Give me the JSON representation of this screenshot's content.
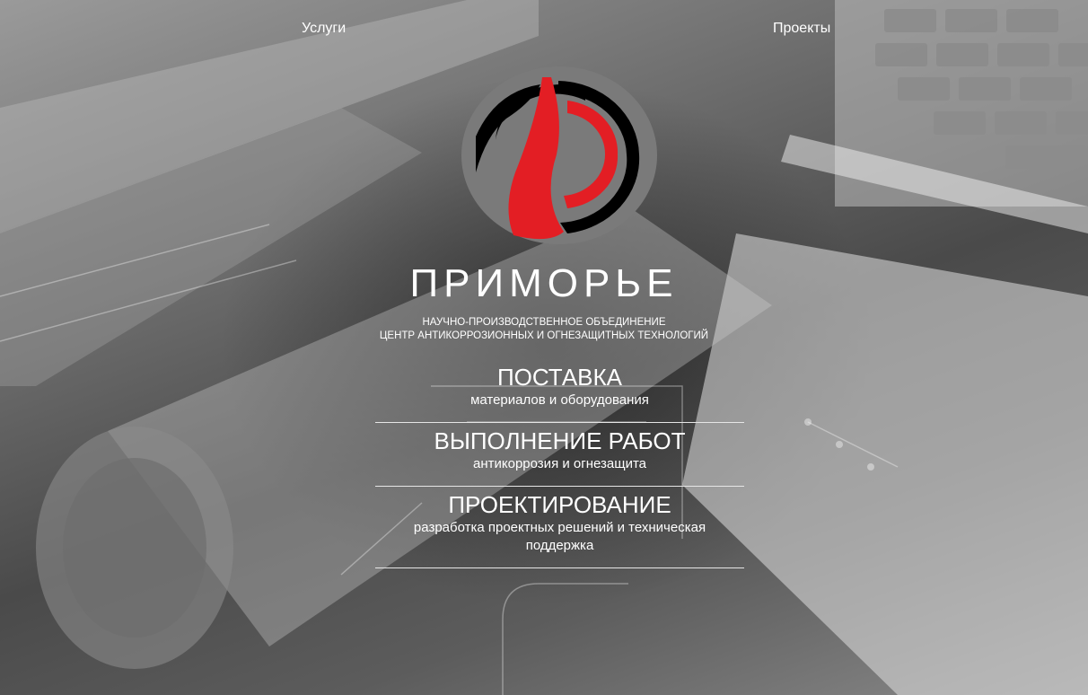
{
  "nav": {
    "services": "Услуги",
    "projects": "Проекты"
  },
  "brand": {
    "name": "ПРИМОРЬЕ",
    "tagline_line1": "НАУЧНО-ПРОИЗВОДСТВЕННОЕ ОБЪЕДИНЕНИЕ",
    "tagline_line2": "ЦЕНТР АНТИКОРРОЗИОННЫХ И ОГНЕЗАЩИТНЫХ ТЕХНОЛОГИЙ"
  },
  "colors": {
    "accent_red": "#e31e24",
    "logo_black": "#000000",
    "logo_gray": "#7a7a7a"
  },
  "menu": [
    {
      "title": "ПОСТАВКА",
      "subtitle": "материалов и оборудования"
    },
    {
      "title": "ВЫПОЛНЕНИЕ РАБОТ",
      "subtitle": "антикоррозия и огнезащита"
    },
    {
      "title": "ПРОЕКТИРОВАНИЕ",
      "subtitle": "разработка проектных решений и техническая поддержка"
    }
  ]
}
